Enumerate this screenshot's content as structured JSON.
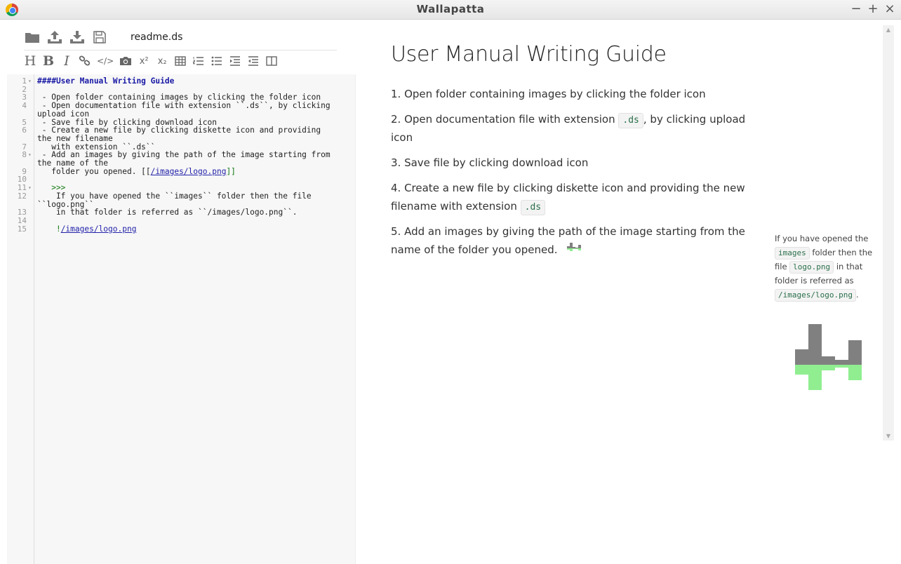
{
  "window": {
    "title": "Wallapatta",
    "controls": [
      "−",
      "+",
      "×"
    ]
  },
  "file_toolbar": {
    "icons": [
      "folder-icon",
      "upload-icon",
      "download-icon",
      "diskette-icon"
    ],
    "filename": "readme.ds"
  },
  "format_toolbar": {
    "heading": "H",
    "bold": "B",
    "italic": "I",
    "code": "</>",
    "superscript": "x²",
    "subscript": "x₂"
  },
  "editor": {
    "line_numbers": [
      "1",
      "2",
      "3",
      "4",
      "5",
      "6",
      "7",
      "8",
      "9",
      "10",
      "11",
      "12",
      "13",
      "14",
      "15"
    ],
    "folds": [
      "▾",
      "▾",
      "▾"
    ],
    "lines": {
      "l1": "####User Manual Writing Guide",
      "l3": " - Open folder containing images by clicking the folder icon",
      "l4a": " - Open documentation file with extension ``.ds``, by clicking",
      "l4b": "upload icon",
      "l5": " - Save file by clicking download icon",
      "l6a": " - Create a new file by clicking diskette icon and providing",
      "l6b": "the new filename",
      "l7": "   with extension ``.ds``",
      "l8a": " - Add an images by giving the path of the image starting from",
      "l8b": "the name of the",
      "l9_pre": "   folder you opened. [[",
      "l9_link": "/images/logo.png",
      "l9_post": "]]",
      "l11": "   >>>",
      "l12a": "    If you have opened the ``images`` folder then the file",
      "l12b": "``logo.png``",
      "l13": "    in that folder is referred as ``/images/logo.png``.",
      "l15_pre": "    !",
      "l15_link": "/images/logo.png"
    }
  },
  "preview": {
    "title": "User Manual Writing Guide",
    "items": {
      "i1": "1. Open folder containing images by clicking the folder icon",
      "i2_pre": "2. Open documentation file with extension",
      "i2_code": ".ds",
      "i2_post": ", by clicking upload icon",
      "i3": "3. Save file by clicking download icon",
      "i4_pre": "4. Create a new file by clicking diskette icon and providing the new filename with extension",
      "i4_code": ".ds",
      "i5_pre": "5. Add an images by giving the path of the image starting from the name of the folder you opened."
    },
    "sidenote": {
      "t1": "If you have opened the",
      "c1": "images",
      "t2": "folder then the file",
      "c2": "logo.png",
      "t3": "in that folder is referred as",
      "c3": "/images/logo.png",
      "t4": "."
    }
  },
  "colors": {
    "logo_gray": "#808080",
    "logo_green": "#90ee90",
    "code_chip_text": "#2a6f4a"
  }
}
